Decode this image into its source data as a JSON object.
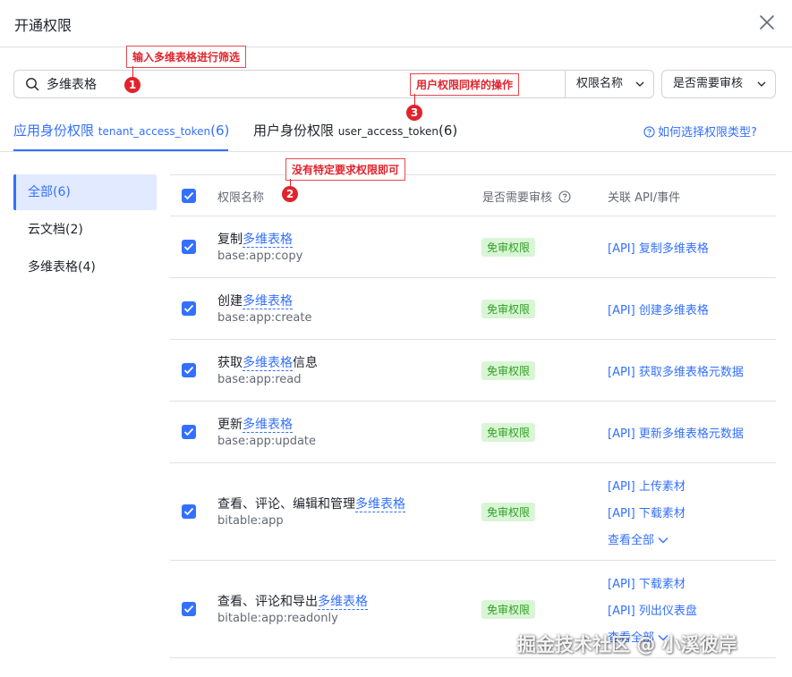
{
  "dialog": {
    "title": "开通权限"
  },
  "search": {
    "value": "多维表格"
  },
  "filters": {
    "name": "权限名称",
    "review": "是否需要审核"
  },
  "tabs": {
    "tenant": {
      "label": "应用身份权限",
      "token": "tenant_access_token",
      "count": "(6)"
    },
    "user": {
      "label": "用户身份权限",
      "token": "user_access_token",
      "count": "(6)"
    },
    "help": "如何选择权限类型?"
  },
  "sidebar": {
    "items": [
      {
        "label": "全部(6)"
      },
      {
        "label": "云文档(2)"
      },
      {
        "label": "多维表格(4)"
      }
    ]
  },
  "table": {
    "headers": {
      "name": "权限名称",
      "review": "是否需要审核",
      "api": "关联 API/事件"
    },
    "rows": [
      {
        "pre": "复制",
        "hl": "多维表格",
        "post": "",
        "key": "base:app:copy",
        "badge": "免审权限",
        "apis": [
          "[API] 复制多维表格"
        ]
      },
      {
        "pre": "创建",
        "hl": "多维表格",
        "post": "",
        "key": "base:app:create",
        "badge": "免审权限",
        "apis": [
          "[API] 创建多维表格"
        ]
      },
      {
        "pre": "获取",
        "hl": "多维表格",
        "post": "信息",
        "key": "base:app:read",
        "badge": "免审权限",
        "apis": [
          "[API] 获取多维表格元数据"
        ]
      },
      {
        "pre": "更新",
        "hl": "多维表格",
        "post": "",
        "key": "base:app:update",
        "badge": "免审权限",
        "apis": [
          "[API] 更新多维表格元数据"
        ]
      },
      {
        "pre": "查看、评论、编辑和管理",
        "hl": "多维表格",
        "post": "",
        "key": "bitable:app",
        "badge": "免审权限",
        "apis": [
          "[API] 上传素材",
          "[API] 下载素材"
        ],
        "more": "查看全部"
      },
      {
        "pre": "查看、评论和导出",
        "hl": "多维表格",
        "post": "",
        "key": "bitable:app:readonly",
        "badge": "免审权限",
        "apis": [
          "[API] 下载素材",
          "[API] 列出仪表盘"
        ],
        "more": "查看全部"
      }
    ]
  },
  "annotations": [
    {
      "num": "1",
      "text": "输入多维表格进行筛选"
    },
    {
      "num": "2",
      "text": "没有特定要求权限即可"
    },
    {
      "num": "3",
      "text": "用户权限同样的操作"
    }
  ],
  "watermark": "掘金技术社区 @ 小溪彼岸",
  "colors": {
    "accent": "#3370ff",
    "badge_bg": "#d9f5d6",
    "badge_text": "#2ea121",
    "annotation": "#e0242c"
  }
}
